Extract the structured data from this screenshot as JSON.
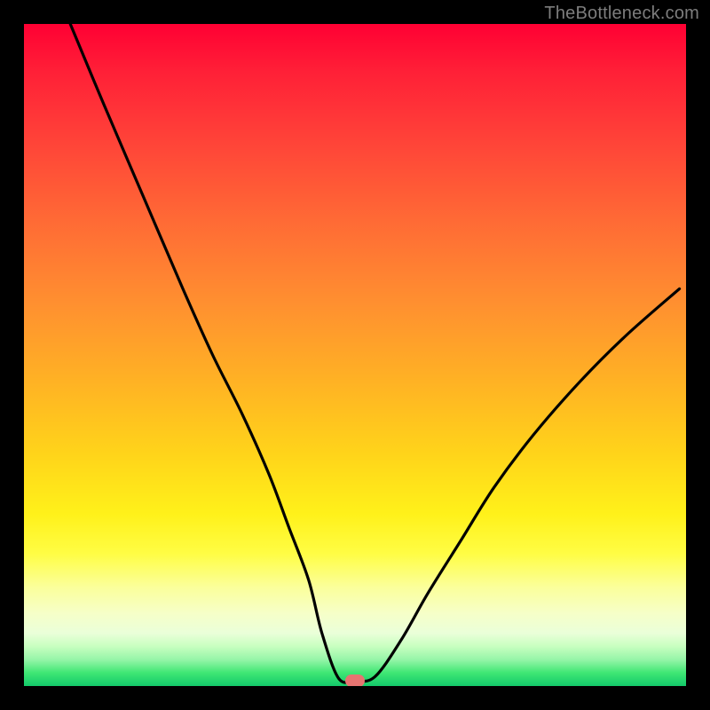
{
  "watermark": "TheBottleneck.com",
  "marker": {
    "x_pct": 50.0,
    "y_pct": 99.2
  },
  "chart_data": {
    "type": "line",
    "title": "",
    "xlabel": "",
    "ylabel": "",
    "xlim": [
      0,
      100
    ],
    "ylim": [
      0,
      100
    ],
    "x": [
      7,
      12,
      18,
      24,
      28.5,
      33,
      37,
      40,
      43,
      45,
      47.5,
      50,
      53,
      57,
      61,
      66,
      71,
      77,
      84,
      91,
      99
    ],
    "y": [
      100,
      88,
      74,
      60,
      50,
      41,
      32,
      24,
      16,
      8,
      1.2,
      0.8,
      1.4,
      7,
      14,
      22,
      30,
      38,
      46,
      53,
      60
    ],
    "series": [
      {
        "name": "bottleneck-curve",
        "color": "#000000"
      }
    ],
    "gradient_stops": [
      {
        "pct": 0,
        "color": "#ff0033"
      },
      {
        "pct": 50,
        "color": "#ffb224"
      },
      {
        "pct": 80,
        "color": "#fffd44"
      },
      {
        "pct": 100,
        "color": "#13c96a"
      }
    ],
    "marker": {
      "x": 50,
      "y": 0.8,
      "color": "#e77471"
    }
  }
}
